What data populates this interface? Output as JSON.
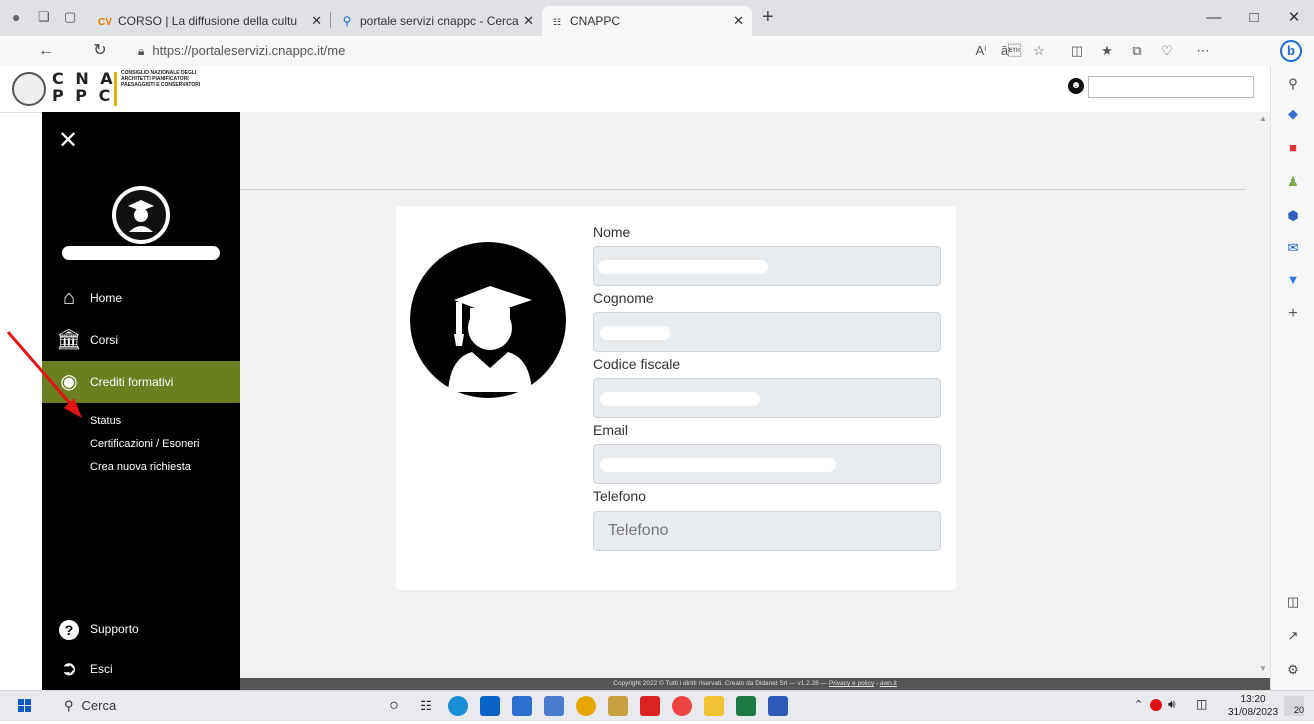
{
  "browser": {
    "tabs": [
      {
        "icon": "cv-icon",
        "label": "CORSO | La diffusione della cultu"
      },
      {
        "icon": "search-icon",
        "label": "portale servizi cnappc - Cerca"
      },
      {
        "icon": "cnappc-icon",
        "label": "CNAPPC"
      }
    ],
    "url": "https://portaleservizi.cnappc.it/me",
    "new_tab": "+"
  },
  "header": {
    "logo_line1": "C N A",
    "logo_line2": "P P C",
    "logo_sub": "Consiglio Nazionale degli Architetti Pianificatori Paesaggisti e Conservatori"
  },
  "sidebar": {
    "items": [
      {
        "label": "Home",
        "icon": "home-icon"
      },
      {
        "label": "Corsi",
        "icon": "bank-icon"
      },
      {
        "label": "Crediti formativi",
        "icon": "award-icon"
      }
    ],
    "sub_items": [
      "Status",
      "Certificazioni / Esoneri",
      "Crea nuova richiesta"
    ],
    "support": "Supporto",
    "logout": "Esci",
    "accent": "#6b7f21"
  },
  "profile": {
    "fields": [
      {
        "label": "Nome",
        "value": ""
      },
      {
        "label": "Cognome",
        "value": ""
      },
      {
        "label": "Codice fiscale",
        "value": ""
      },
      {
        "label": "Email",
        "value": ""
      },
      {
        "label": "Telefono",
        "placeholder": "Telefono"
      }
    ]
  },
  "footer": {
    "text": "Copyright 2022 © Tutti i diritti riservati. Creato da Didanet Srl — v1.2.28 —",
    "privacy": "Privacy e policy",
    "sep": " - ",
    "link2": "awn.it"
  },
  "taskbar": {
    "search": "Cerca",
    "time": "13:20",
    "date": "31/08/2023",
    "notif": "20"
  }
}
